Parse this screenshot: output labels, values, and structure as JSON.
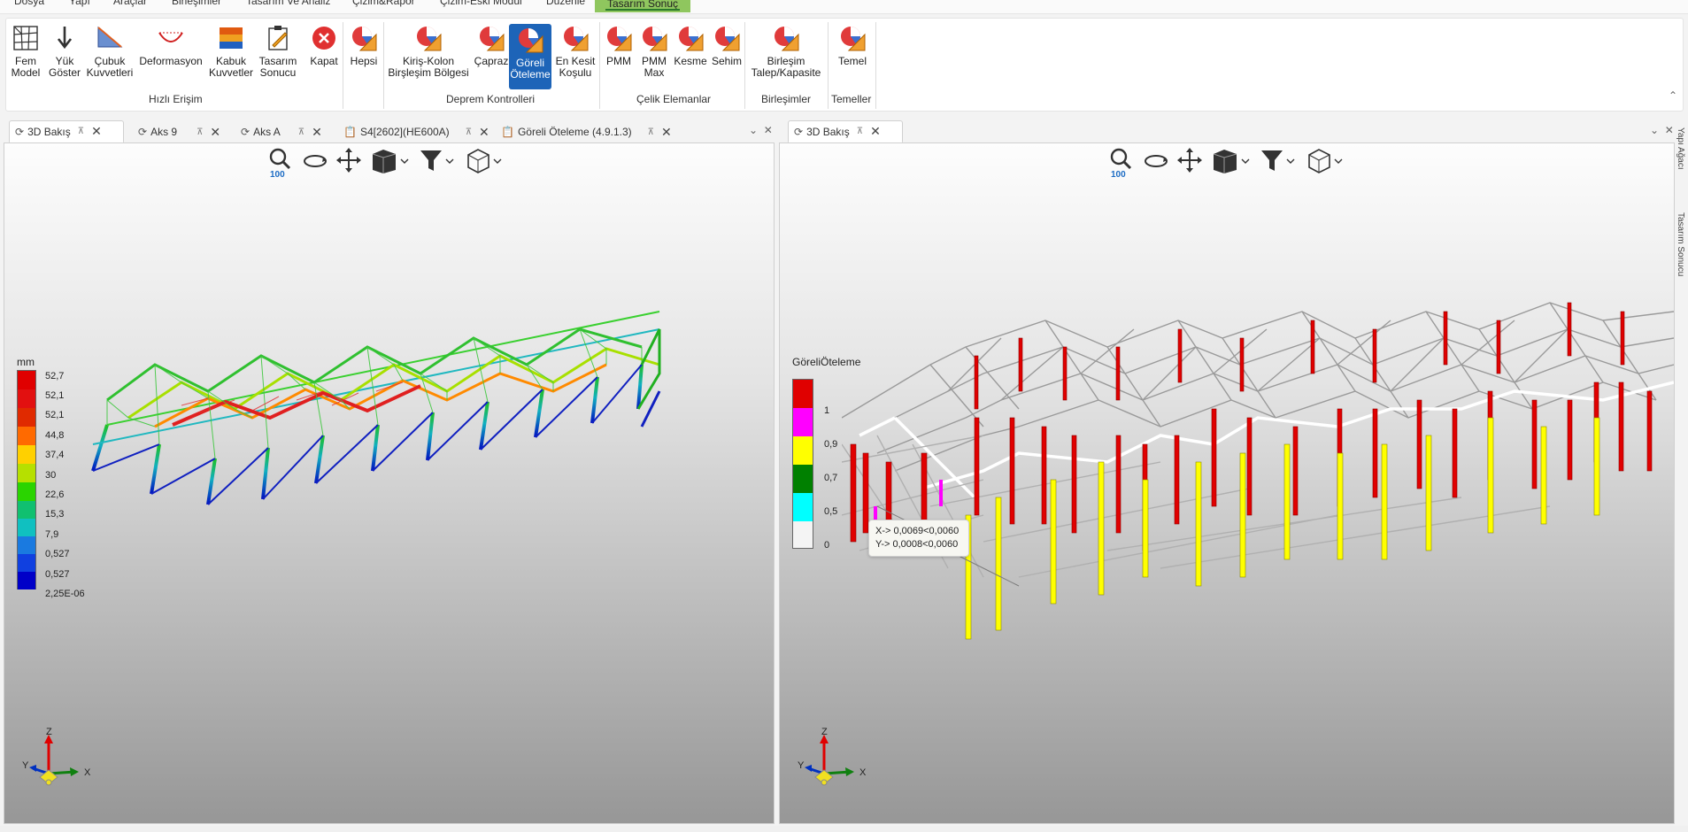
{
  "menu": [
    "Dosya",
    "Yapı",
    "Araçlar",
    "Birleşimler",
    "Tasarım Ve Analiz",
    "Çizim&Rapor",
    "Çizim-Eski Modül",
    "Düzenle",
    "Tasarım Sonuç"
  ],
  "ribbon": {
    "buttons": {
      "fem_model": "Fem\nModel",
      "yuk_goster": "Yük\nGöster",
      "cubuk_kuvvetleri": "Çubuk\nKuvvetleri",
      "deformasyon": "Deformasyon",
      "kabuk_kuvvetler": "Kabuk\nKuvvetler",
      "tasarim_sonucu": "Tasarım\nSonucu",
      "kapat": "Kapat",
      "hepsi": "Hepsi",
      "kiris_kolon": "Kiriş-Kolon\nBirşleşim Bölgesi",
      "capraz": "Çapraz",
      "goreli_oteleme": "Göreli\nÖteleme",
      "en_kesit": "En Kesit\nKoşulu",
      "pmm": "PMM",
      "pmm_max": "PMM\nMax",
      "kesme": "Kesme",
      "sehim": "Sehim",
      "birlesim": "Birleşim\nTalep/Kapasite",
      "temel": "Temel"
    },
    "groups": {
      "hizli": "Hızlı Erişim",
      "deprem": "Deprem Kontrolleri",
      "celik": "Çelik Elemanlar",
      "birlesimler": "Birleşimler",
      "temeller": "Temeller"
    }
  },
  "tabs_left": [
    {
      "label": "3D Bakış"
    },
    {
      "label": "Aks 9"
    },
    {
      "label": "Aks A"
    },
    {
      "label": "S4[2602](HE600A)"
    },
    {
      "label": "Göreli Öteleme (4.9.1.3)"
    }
  ],
  "tabs_right": [
    {
      "label": "3D Bakış"
    }
  ],
  "left_view": {
    "zoom": "100",
    "legend_unit": "mm",
    "legend_values": [
      "52,7",
      "52,1",
      "52,1",
      "44,8",
      "37,4",
      "30",
      "22,6",
      "15,3",
      "7,9",
      "0,527",
      "0,527",
      "2,25E-06"
    ],
    "legend_colors": [
      "#e00000",
      "#e21010",
      "#e02a00",
      "#ff5a00",
      "#ffd000",
      "#b6e000",
      "#2ad400",
      "#10c070",
      "#10c0c0",
      "#1a7ae0",
      "#1040e0",
      "#0000c8"
    ],
    "axis_labels": {
      "z": "Z",
      "y": "Y",
      "x": "X"
    }
  },
  "right_view": {
    "zoom": "100",
    "legend_title": "GöreliÖteleme",
    "legend_values": [
      "1",
      "0,9",
      "0,7",
      "0,5",
      "0"
    ],
    "legend_colors": [
      "#e00000",
      "#ff00ff",
      "#ffff00",
      "#008000",
      "#00ffff",
      "#f4f4f4"
    ],
    "tooltip": {
      "x": "X-> 0,0069<0,0060",
      "y": "Y-> 0,0008<0,0060"
    },
    "axis_labels": {
      "z": "Z",
      "y": "Y",
      "x": "X"
    }
  },
  "side_dock": {
    "top": "Yapı Ağacı",
    "bottom": "Tasarım Sonucu"
  }
}
